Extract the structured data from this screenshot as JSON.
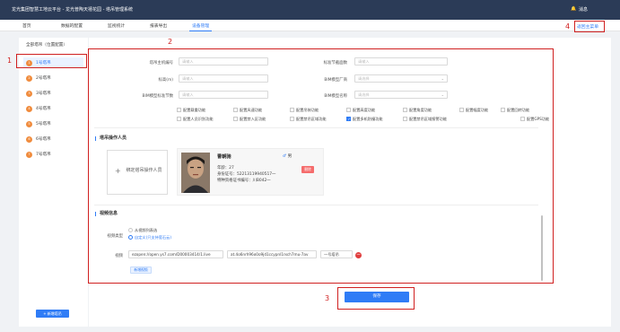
{
  "app_title": "龙光集团智慧工地云平台 - 龙光普陶天禧花园 - 塔吊管理系统",
  "header": {
    "bell_icon": "bell-icon",
    "messages_label": "消息"
  },
  "nav": {
    "tabs": [
      "首页",
      "数据的配置",
      "监视统计",
      "报表导出",
      "设备管理"
    ],
    "active_tab": "设备管理",
    "back_link": "返回主菜单"
  },
  "sidebar": {
    "header": "全部塔吊（位置配置）",
    "items": [
      {
        "num": "1",
        "label": "1号塔吊"
      },
      {
        "num": "2",
        "label": "2号塔吊"
      },
      {
        "num": "3",
        "label": "3号塔吊"
      },
      {
        "num": "4",
        "label": "4号塔吊"
      },
      {
        "num": "5",
        "label": "5号塔吊"
      },
      {
        "num": "6",
        "label": "6号塔吊"
      },
      {
        "num": "7",
        "label": "7号塔吊"
      }
    ],
    "add_button": "+ 新增塔吊"
  },
  "form": {
    "fields": [
      {
        "label": "塔吊主机编号",
        "placeholder": "请输入"
      },
      {
        "label": "标准节截面数",
        "placeholder": "请输入"
      },
      {
        "label": "标高(m)",
        "placeholder": "请输入"
      },
      {
        "label": "BIM模型厂商",
        "placeholder": "请选择"
      },
      {
        "label": "BIM模型标准节数",
        "placeholder": "请输入"
      },
      {
        "label": "BIM模型名称",
        "placeholder": "请选择"
      }
    ],
    "checkboxes_row1": [
      "配置载重功能",
      "配置风速功能",
      "配置吊装功能",
      "配置高度功能",
      "配置角度功能",
      "配置幅度功能",
      "配置回转功能",
      "配置GPS功能"
    ],
    "checkboxes_row2": [
      "配置人员识别功能",
      "配置禁入区功能",
      "配置禁吊区域功能",
      "配置多机防撞功能",
      "配置禁吊区域报警功能"
    ],
    "checked_row2_index": 3
  },
  "operators": {
    "title": "塔吊操作人员",
    "bind_button": "绑定塔吊操作人员",
    "card": {
      "name": "曹朝驰",
      "gender": "男",
      "age": "年龄：27",
      "id_number": "身份证号：52213119940517一",
      "cert_number": "特种资格证书编号：川B042一",
      "delete_label": "删除"
    }
  },
  "video": {
    "title": "视频信息",
    "type_label": "视频类型",
    "type_options": [
      "从视频列表选",
      "自定义(只支持萤石云)"
    ],
    "selected_type_index": 1,
    "address_label": "视频",
    "url": "ezopen://open.ys7.com/D00003414/1.live",
    "token": "at.4o6nrh96o0o9jd1ccypnl1rxch7mu-7av",
    "name": "一号塔吊",
    "add_button": "新增视频"
  },
  "save_button": "保存",
  "annotations": [
    "1",
    "2",
    "3",
    "4"
  ],
  "colors": {
    "accent": "#2f7cf6",
    "header_bg": "#2b3b57",
    "badge": "#f08c3e",
    "annotation": "#d02020",
    "danger": "#e03e3e"
  }
}
